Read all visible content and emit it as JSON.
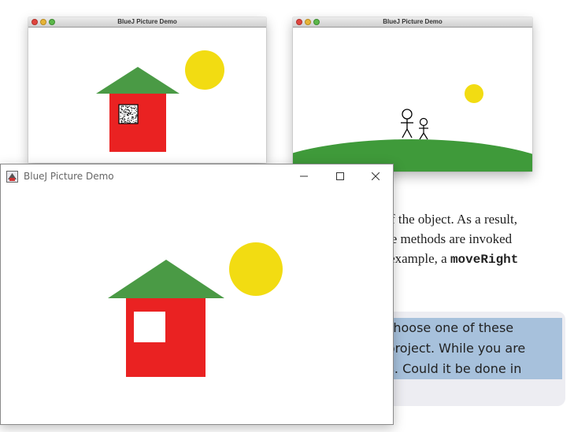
{
  "colors": {
    "wall_red": "#ea2222",
    "roof_green": "#4a9a45",
    "sun_yellow": "#f2dc12",
    "hill_green": "#3f9a3a",
    "highlight_blue": "#a7c1dc"
  },
  "book": {
    "para_line1": "ss of the object. As a result,",
    "para_line2": "r, the methods are invoked",
    "para_line3_prefix": "for example, a ",
    "para_code": "moveRight",
    "exercise_line1": ". Choose one of these",
    "exercise_line2": "s project. While you are",
    "exercise_line3": "his. Could it be done in"
  },
  "mac_window_1": {
    "title": "BlueJ Picture Demo"
  },
  "mac_window_2": {
    "title": "BlueJ Picture Demo"
  },
  "win_window": {
    "title": "BlueJ Picture Demo",
    "icons": {
      "app": "bluej-icon",
      "minimize": "minimize-icon",
      "maximize": "maximize-icon",
      "close": "close-icon"
    }
  }
}
